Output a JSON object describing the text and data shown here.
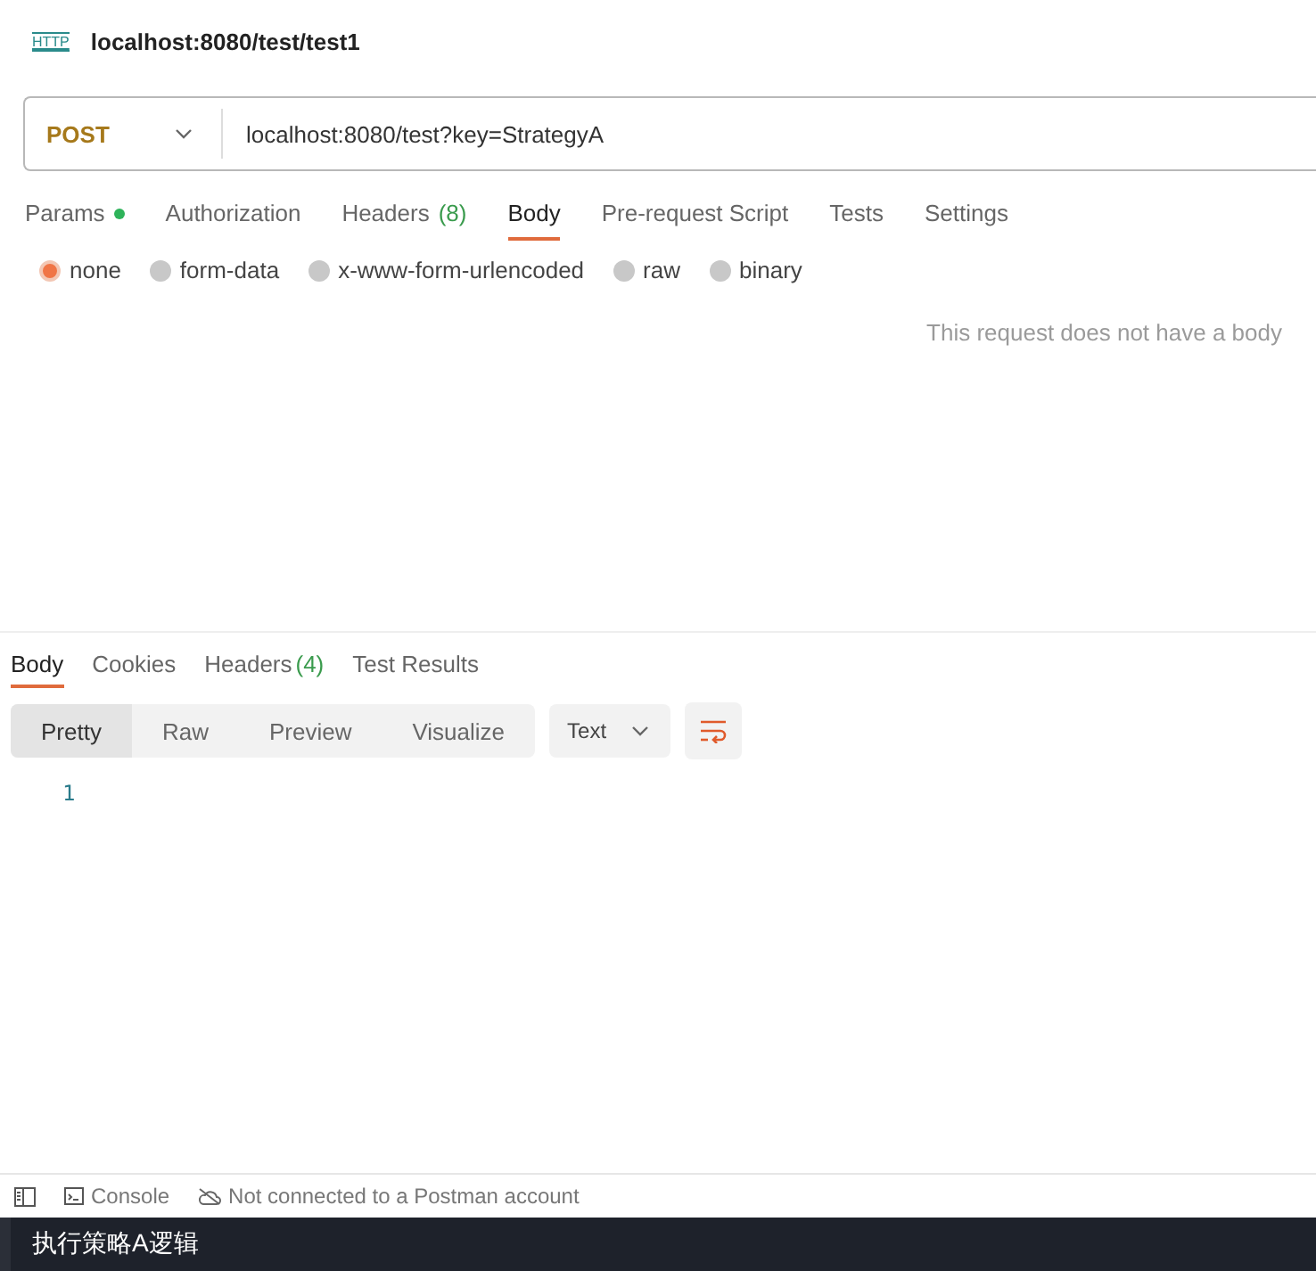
{
  "header": {
    "icon_label": "HTTP",
    "title": "localhost:8080/test/test1"
  },
  "request": {
    "method": "POST",
    "url": "localhost:8080/test?key=StrategyA"
  },
  "request_tabs": [
    {
      "label": "Params",
      "dot": true,
      "selected": false
    },
    {
      "label": "Authorization",
      "dot": false,
      "selected": false
    },
    {
      "label": "Headers",
      "dot": false,
      "count": "(8)",
      "selected": false
    },
    {
      "label": "Body",
      "dot": false,
      "selected": true
    },
    {
      "label": "Pre-request Script",
      "dot": false,
      "selected": false
    },
    {
      "label": "Tests",
      "dot": false,
      "selected": false
    },
    {
      "label": "Settings",
      "dot": false,
      "selected": false
    }
  ],
  "body_types": [
    {
      "label": "none",
      "selected": true
    },
    {
      "label": "form-data",
      "selected": false
    },
    {
      "label": "x-www-form-urlencoded",
      "selected": false
    },
    {
      "label": "raw",
      "selected": false
    },
    {
      "label": "binary",
      "selected": false
    }
  ],
  "body_message": "This request does not have a body",
  "response_tabs": [
    {
      "label": "Body",
      "selected": true
    },
    {
      "label": "Cookies",
      "selected": false
    },
    {
      "label": "Headers",
      "count": "(4)",
      "selected": false
    },
    {
      "label": "Test Results",
      "selected": false
    }
  ],
  "view_modes": [
    {
      "label": "Pretty",
      "selected": true
    },
    {
      "label": "Raw",
      "selected": false
    },
    {
      "label": "Preview",
      "selected": false
    },
    {
      "label": "Visualize",
      "selected": false
    }
  ],
  "format": "Text",
  "line_numbers": [
    "1"
  ],
  "status_bar": {
    "console": "Console",
    "account": "Not connected to a Postman account"
  },
  "output": "执行策略A逻辑"
}
